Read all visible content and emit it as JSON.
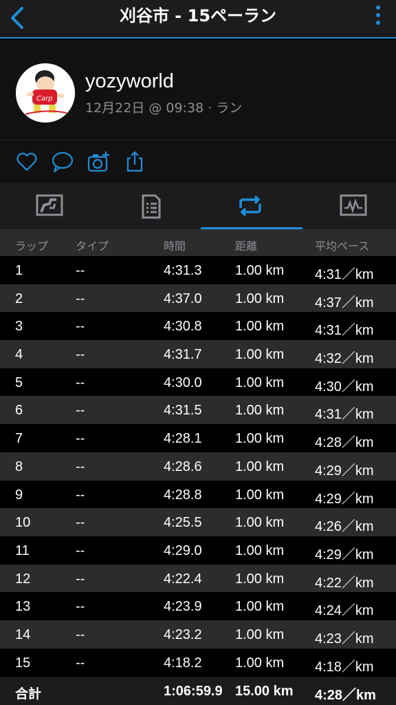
{
  "topbar": {
    "title": "刈谷市 - 15ペーラン"
  },
  "profile": {
    "username": "yozyworld",
    "meta": "12月22日 @ 09:38 · ラン"
  },
  "accent": "#1f8fd8",
  "table": {
    "headers": [
      "ラップ",
      "タイプ",
      "時間",
      "距離",
      "平均ペース"
    ],
    "rows": [
      [
        "1",
        "--",
        "4:31.3",
        "1.00 km",
        "4:31／km"
      ],
      [
        "2",
        "--",
        "4:37.0",
        "1.00 km",
        "4:37／km"
      ],
      [
        "3",
        "--",
        "4:30.8",
        "1.00 km",
        "4:31／km"
      ],
      [
        "4",
        "--",
        "4:31.7",
        "1.00 km",
        "4:32／km"
      ],
      [
        "5",
        "--",
        "4:30.0",
        "1.00 km",
        "4:30／km"
      ],
      [
        "6",
        "--",
        "4:31.5",
        "1.00 km",
        "4:31／km"
      ],
      [
        "7",
        "--",
        "4:28.1",
        "1.00 km",
        "4:28／km"
      ],
      [
        "8",
        "--",
        "4:28.6",
        "1.00 km",
        "4:29／km"
      ],
      [
        "9",
        "--",
        "4:28.8",
        "1.00 km",
        "4:29／km"
      ],
      [
        "10",
        "--",
        "4:25.5",
        "1.00 km",
        "4:26／km"
      ],
      [
        "11",
        "--",
        "4:29.0",
        "1.00 km",
        "4:29／km"
      ],
      [
        "12",
        "--",
        "4:22.4",
        "1.00 km",
        "4:22／km"
      ],
      [
        "13",
        "--",
        "4:23.9",
        "1.00 km",
        "4:24／km"
      ],
      [
        "14",
        "--",
        "4:23.2",
        "1.00 km",
        "4:23／km"
      ],
      [
        "15",
        "--",
        "4:18.2",
        "1.00 km",
        "4:18／km"
      ]
    ],
    "total": {
      "label": "合計",
      "time": "1:06:59.9",
      "distance": "15.00 km",
      "pace": "4:28／km"
    }
  }
}
